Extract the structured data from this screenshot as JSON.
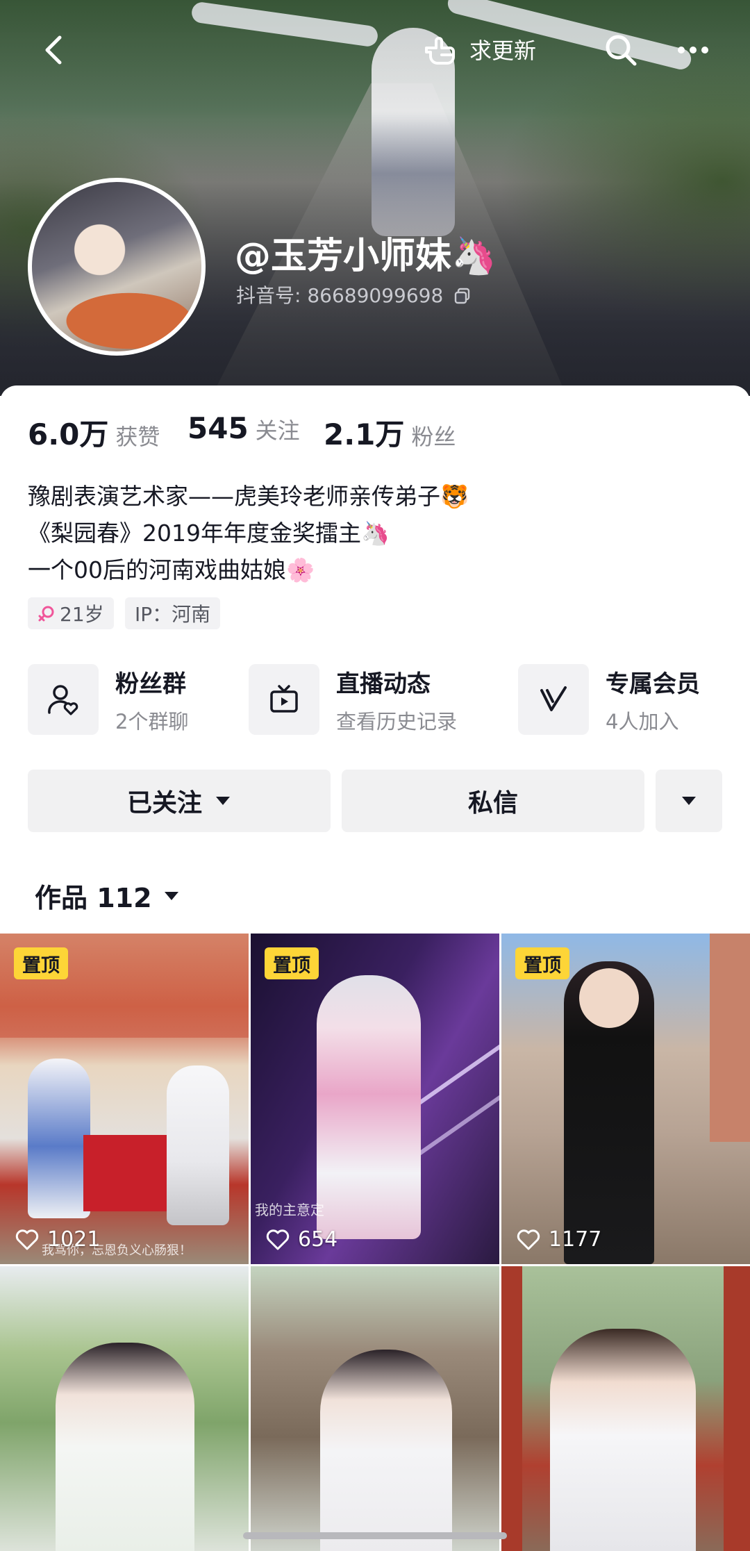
{
  "header": {
    "request_update_label": "求更新",
    "username": "@玉芳小师妹🦄",
    "douyin_id": "抖音号: 86689099698"
  },
  "stats": [
    {
      "value": "6.0万",
      "label": "获赞"
    },
    {
      "value": "545",
      "label": "关注"
    },
    {
      "value": "2.1万",
      "label": "粉丝"
    }
  ],
  "bio": [
    "豫剧表演艺术家——虎美玲老师亲传弟子🐯",
    "《梨园春》2019年年度金奖擂主🦄",
    "一个00后的河南戏曲姑娘🌸"
  ],
  "tags": {
    "age": "21岁",
    "ip": "IP：河南"
  },
  "features": [
    {
      "title": "粉丝群",
      "sub": "2个群聊",
      "icon": "fan-group-icon"
    },
    {
      "title": "直播动态",
      "sub": "查看历史记录",
      "icon": "live-tv-icon"
    },
    {
      "title": "专属会员",
      "sub": "4人加入",
      "icon": "member-v-icon"
    }
  ],
  "actions": {
    "following": "已关注",
    "message": "私信"
  },
  "works": {
    "label": "作品 112"
  },
  "videos": [
    {
      "pinned": "置顶",
      "likes": "1021",
      "caption": "我骂你，忘恩负义心肠狠！"
    },
    {
      "pinned": "置顶",
      "likes": "654",
      "caption": "我的主意定"
    },
    {
      "pinned": "置顶",
      "likes": "1177"
    },
    {},
    {},
    {}
  ],
  "colors": {
    "accent": "#fdd537",
    "text": "#161823",
    "muted": "#8a8b91",
    "button_bg": "#f1f1f2"
  }
}
